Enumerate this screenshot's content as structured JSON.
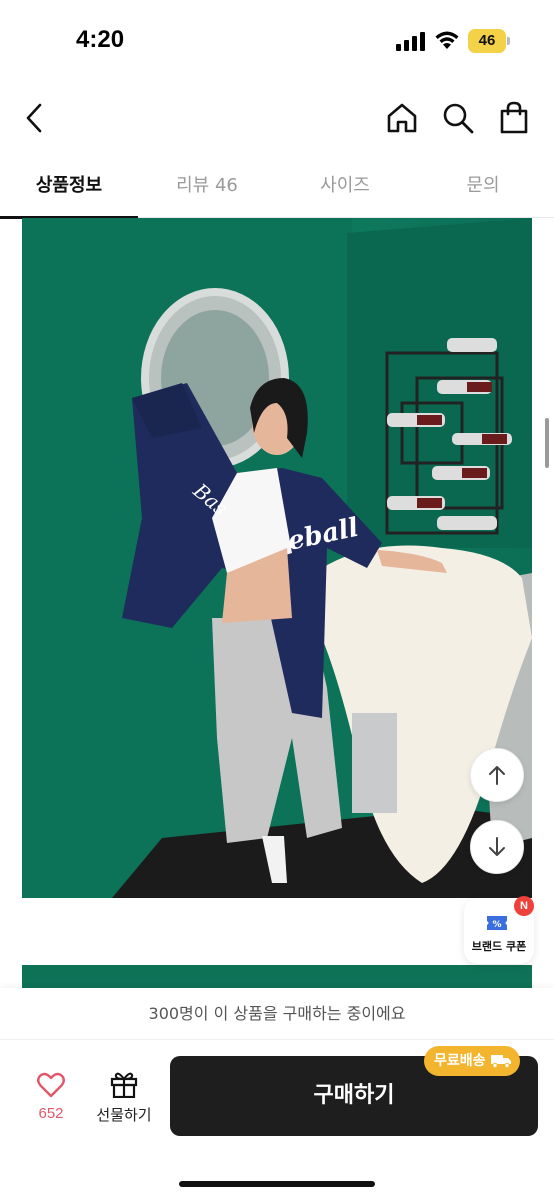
{
  "status_bar": {
    "time": "4:20",
    "battery": "46"
  },
  "tabs": [
    {
      "label": "상품정보",
      "active": true
    },
    {
      "label": "리뷰 46",
      "active": false
    },
    {
      "label": "사이즈",
      "active": false
    },
    {
      "label": "문의",
      "active": false
    }
  ],
  "product_image": {
    "jersey_text_left": "Bas",
    "jersey_text_right": "eball"
  },
  "coupon": {
    "label": "브랜드 쿠폰",
    "badge": "N"
  },
  "bottom": {
    "buyers_notice": "300명이 이 상품을 구매하는 중이에요",
    "like_count": "652",
    "gift_label": "선물하기",
    "free_shipping": "무료배송",
    "buy_label": "구매하기"
  },
  "colors": {
    "accent_like": "#e0586a",
    "free_ship": "#f3b42e",
    "buy_button": "#1e1e1e"
  }
}
